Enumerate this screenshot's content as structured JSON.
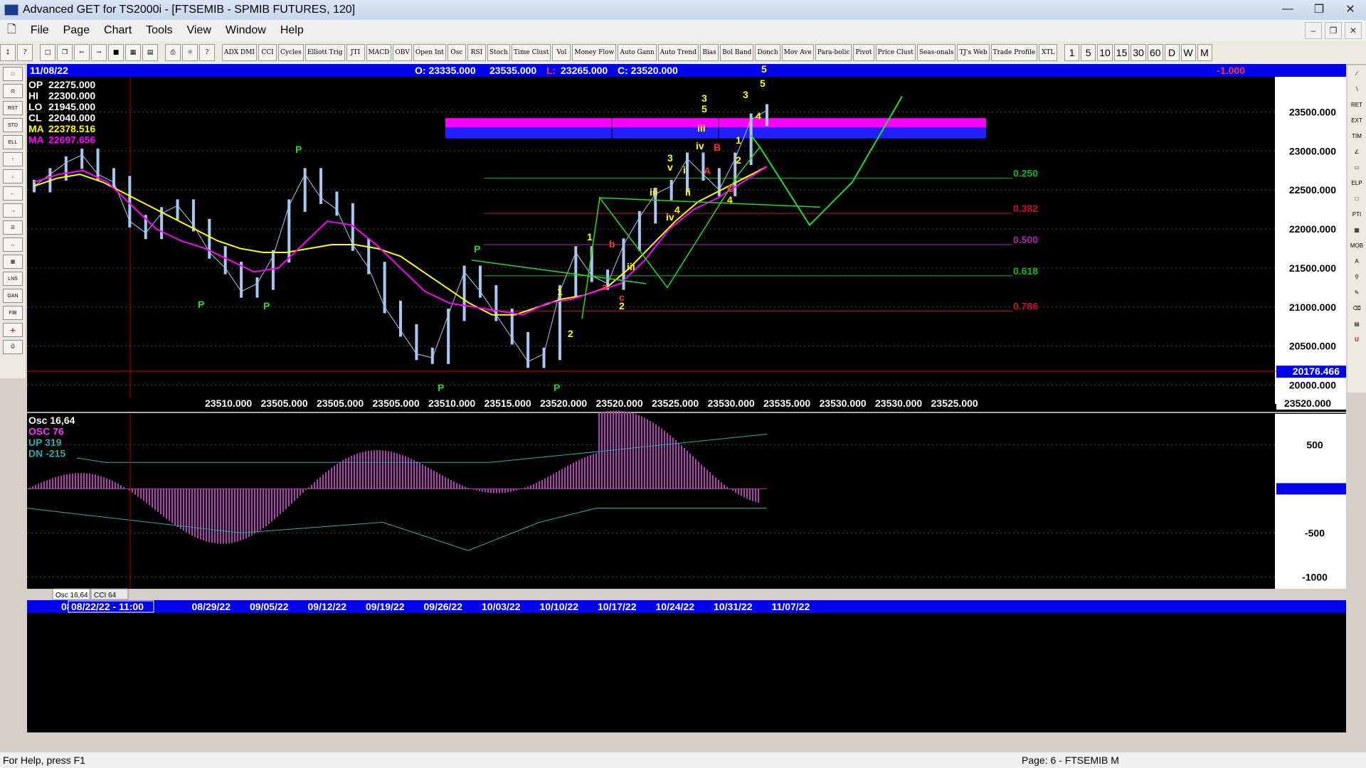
{
  "window": {
    "title": "Advanced GET for TS2000i - [FTSEMIB - SPMIB FUTURES, 120]"
  },
  "menu": [
    "File",
    "Page",
    "Chart",
    "Tools",
    "View",
    "Window",
    "Help"
  ],
  "toolbar": {
    "studies": [
      "ADX DMI",
      "CCI",
      "Cycles",
      "Elliott Trig",
      "JTI",
      "MACD",
      "OBV",
      "Open Int",
      "Osc",
      "RSI",
      "Stoch",
      "Time Clust",
      "Vol",
      "Money Flow",
      "Auto Gann",
      "Auto Trend",
      "Bias",
      "Bol Band",
      "Donch",
      "Mov Ave",
      "Para-bolic",
      "Pivot",
      "Price Clust",
      "Seas-onals",
      "TJ's Web",
      "Trade Profile",
      "XTL"
    ],
    "intervals": [
      "1",
      "5",
      "10",
      "15",
      "30",
      "60",
      "D",
      "W",
      "M"
    ]
  },
  "header": {
    "date": "11/08/22",
    "open": "O: 23335.000",
    "high": "23535.000",
    "low_label": "L:",
    "low": "23265.000",
    "close": "C: 23520.000",
    "change": "-1.000"
  },
  "info": [
    {
      "k": "OP",
      "v": "22275.000",
      "color": "#ffffff"
    },
    {
      "k": "HI",
      "v": "22300.000",
      "color": "#ffffff"
    },
    {
      "k": "LO",
      "v": "21945.000",
      "color": "#ffffff"
    },
    {
      "k": "CL",
      "v": "22040.000",
      "color": "#ffffff"
    },
    {
      "k": "MA",
      "v": "22378.516",
      "color": "#ffff00"
    },
    {
      "k": "MA",
      "v": "22697.656",
      "color": "#ff00ff"
    }
  ],
  "price_axis": {
    "ticks": [
      "23500.000",
      "23000.000",
      "22500.000",
      "22000.000",
      "21500.000",
      "21000.000",
      "20500.000",
      "20000.000"
    ],
    "ylim": [
      19850,
      23950
    ],
    "current": "20176.466"
  },
  "fib": [
    {
      "label": "0.250",
      "value": 22650,
      "color": "#11b811"
    },
    {
      "label": "0.382",
      "value": 22200,
      "color": "#c8102e"
    },
    {
      "label": "0.500",
      "value": 21800,
      "color": "#b020b0"
    },
    {
      "label": "0.618",
      "value": 21400,
      "color": "#11b811"
    },
    {
      "label": "0.786",
      "value": 20950,
      "color": "#c8102e"
    }
  ],
  "price_row": [
    "23510.000",
    "23505.000",
    "23505.000",
    "23505.000",
    "23510.000",
    "23515.000",
    "23520.000",
    "23520.000",
    "23525.000",
    "23530.000",
    "23535.000",
    "23530.000",
    "23530.000",
    "23525.000"
  ],
  "price_row_last": "23520.000",
  "osc": {
    "labels": [
      {
        "t": "Osc 16,64",
        "color": "#ffffff"
      },
      {
        "t": "OSC 76",
        "color": "#ff33ff"
      },
      {
        "t": "UP  319",
        "color": "#22b0b0"
      },
      {
        "t": "DN  -215",
        "color": "#22b0b0"
      }
    ],
    "ticks": [
      "500",
      "0",
      "-500",
      "-1000"
    ],
    "ylim": [
      -1150,
      850
    ]
  },
  "tabs": [
    "Osc 16,64",
    "CCI 64"
  ],
  "dates": [
    "08",
    "08/22/22 - 11:00",
    "08/29/22",
    "09/05/22",
    "09/12/22",
    "09/19/22",
    "09/26/22",
    "10/03/22",
    "10/10/22",
    "10/17/22",
    "10/24/22",
    "10/31/22",
    "11/07/22"
  ],
  "status": {
    "left": "For Help, press F1",
    "right": "Page: 6 - FTSEMIB M"
  },
  "chart_data": {
    "type": "line",
    "title": "FTSEMIB - SPMIB FUTURES, 120",
    "series": [
      {
        "name": "Price",
        "values": [
          22550,
          22700,
          22850,
          22950,
          22700,
          22600,
          22100,
          21950,
          22200,
          22300,
          22050,
          21700,
          21500,
          21200,
          21300,
          21650,
          22300,
          22700,
          22400,
          22250,
          21800,
          21500,
          21000,
          20700,
          20400,
          20350,
          20900,
          21450,
          21200,
          20900,
          20600,
          20300,
          20400,
          21200,
          21700,
          21400,
          21300,
          21800,
          22150,
          22450,
          22550,
          22900,
          22700,
          22500,
          22900,
          23400,
          23520
        ]
      },
      {
        "name": "MA",
        "values": [
          22550,
          22650,
          22700,
          22600,
          22450,
          22300,
          22150,
          22000,
          21850,
          21750,
          21700,
          21700,
          21750,
          21800,
          21800,
          21750,
          21650,
          21450,
          21250,
          21050,
          20900,
          20900,
          21000,
          21100,
          21150,
          21250,
          21500,
          21800,
          22100,
          22350,
          22500,
          22650,
          22800
        ]
      },
      {
        "name": "MA",
        "values": [
          22600,
          22700,
          22750,
          22600,
          22300,
          22000,
          21850,
          21750,
          21600,
          21450,
          21500,
          21800,
          22100,
          22050,
          21800,
          21500,
          21200,
          21050,
          21000,
          20950,
          20900,
          21050,
          21100,
          21200,
          21300,
          21600,
          22000,
          22250,
          22400,
          22600,
          22800
        ]
      }
    ]
  }
}
